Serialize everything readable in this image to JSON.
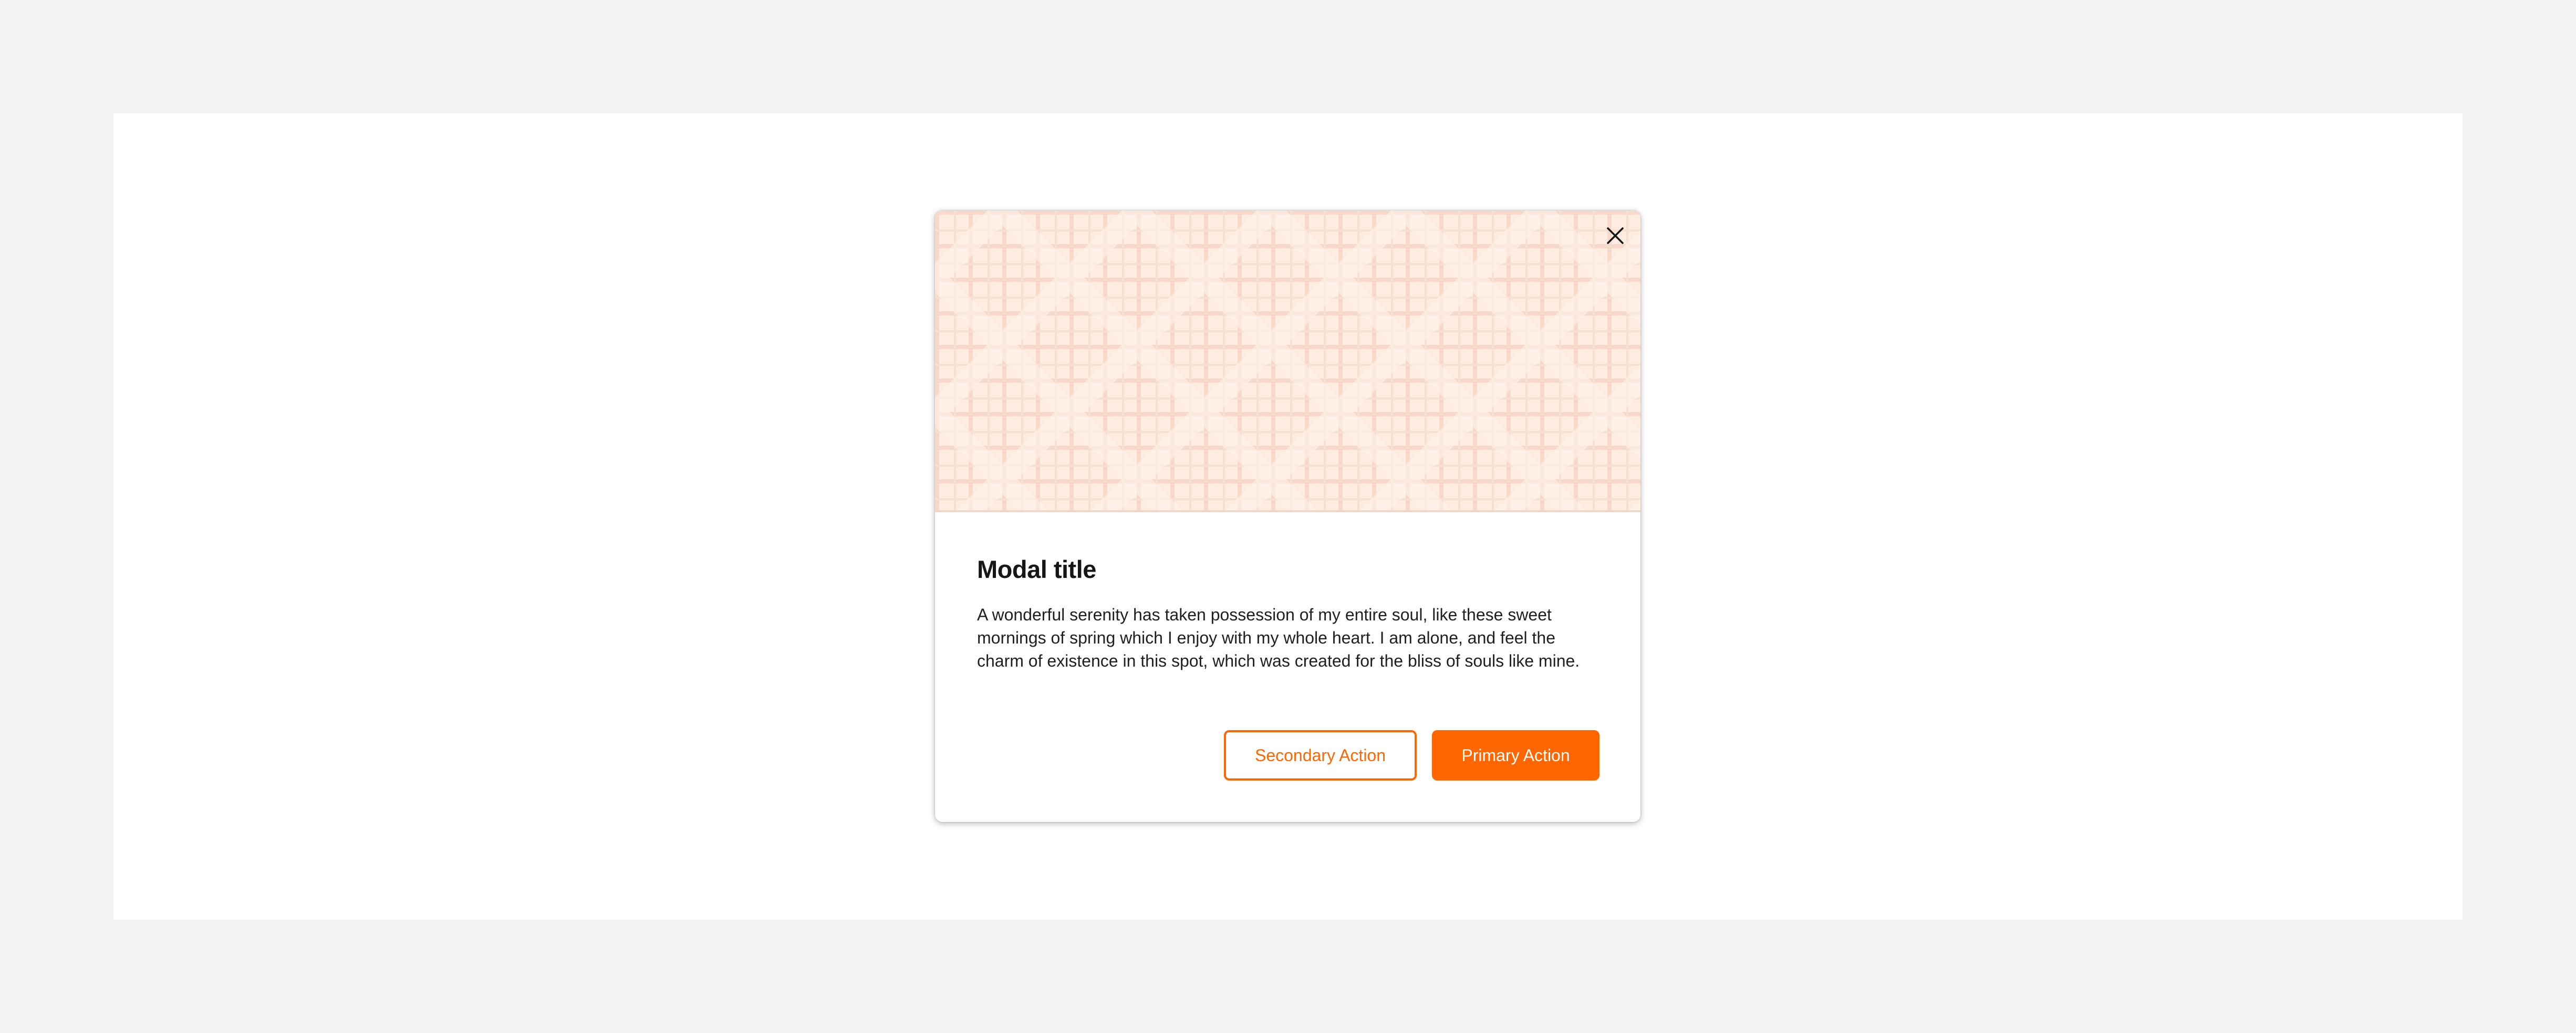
{
  "modal": {
    "title": "Modal title",
    "body_text": "A wonderful serenity has taken possession of my entire soul, like these sweet mornings of spring which I enjoy with my whole heart. I am alone, and feel the charm of existence in this spot, which was created for the bliss of souls like mine.",
    "close_icon": "close-icon",
    "hero_pattern": "grid-pattern",
    "secondary_label": "Secondary Action",
    "primary_label": "Primary Action"
  },
  "colors": {
    "page_background": "#f4f4f4",
    "canvas_background": "#ffffff",
    "hero_background": "#fdecdf",
    "accent": "#ff6600",
    "title_text": "#161616"
  }
}
